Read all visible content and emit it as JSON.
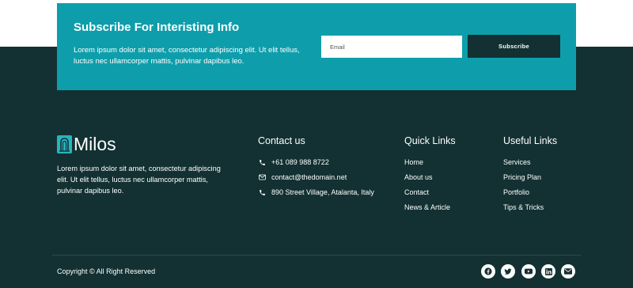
{
  "subscribe": {
    "title": "Subscribe For Interisting Info",
    "text": "Lorem ipsum dolor sit amet, consectetur adipiscing elit. Ut elit tellus, luctus nec ullamcorper mattis, pulvinar dapibus leo.",
    "email_placeholder": "Email",
    "button_label": "Subscribe"
  },
  "brand": {
    "name": "Milos",
    "description": "Lorem ipsum dolor sit amet, consectetur adipiscing elit. Ut elit tellus, luctus nec ullamcorper mattis, pulvinar dapibus leo."
  },
  "contact": {
    "title": "Contact us",
    "items": [
      {
        "icon": "phone-icon",
        "text": "+61 089 988 8722"
      },
      {
        "icon": "envelope-icon",
        "text": "contact@thedomain.net"
      },
      {
        "icon": "phone-icon",
        "text": "890 Street Village, Atalanta, Italy"
      }
    ]
  },
  "quick_links": {
    "title": "Quick Links",
    "items": [
      "Home",
      "About us",
      "Contact",
      "News & Article"
    ]
  },
  "useful_links": {
    "title": "Useful Links",
    "items": [
      "Services",
      "Pricing Plan",
      "Portfolio",
      "Tips & Tricks"
    ]
  },
  "footer": {
    "copyright": "Copyright © All Right Reserved",
    "social": [
      "facebook-icon",
      "twitter-icon",
      "youtube-icon",
      "linkedin-icon",
      "email-icon"
    ]
  },
  "colors": {
    "accent": "#0e9eab",
    "footer_bg": "#133132"
  }
}
